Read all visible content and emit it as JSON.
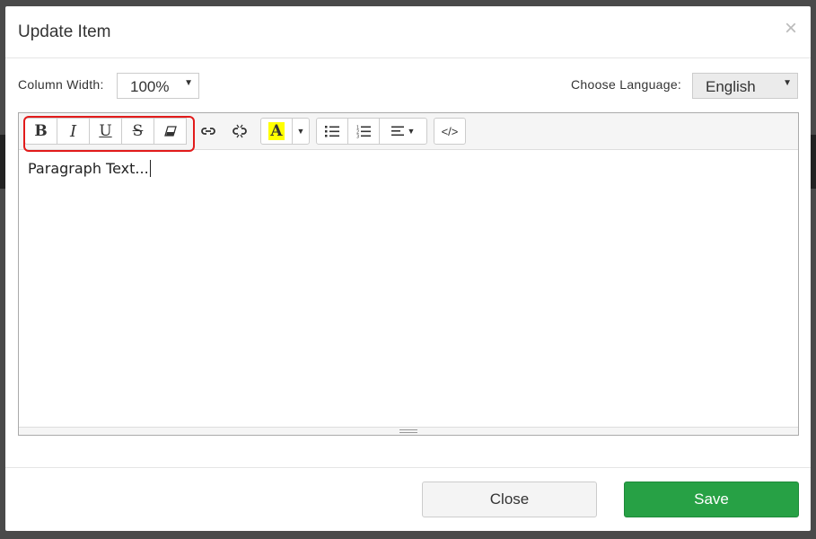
{
  "dialog": {
    "title": "Update Item",
    "close_glyph": "×"
  },
  "column_width": {
    "label": "Column Width:",
    "value": "100%"
  },
  "language": {
    "label": "Choose Language:",
    "value": "English"
  },
  "toolbar": {
    "bold": "B",
    "italic": "I",
    "underline": "U",
    "strikethrough": "S",
    "highlight_color": "#ffff00",
    "code_view": "</>"
  },
  "editor": {
    "text": "Paragraph Text..."
  },
  "footer": {
    "close_label": "Close",
    "save_label": "Save"
  },
  "colors": {
    "save_green": "#27a145",
    "highlight_red": "#e21b1b"
  }
}
